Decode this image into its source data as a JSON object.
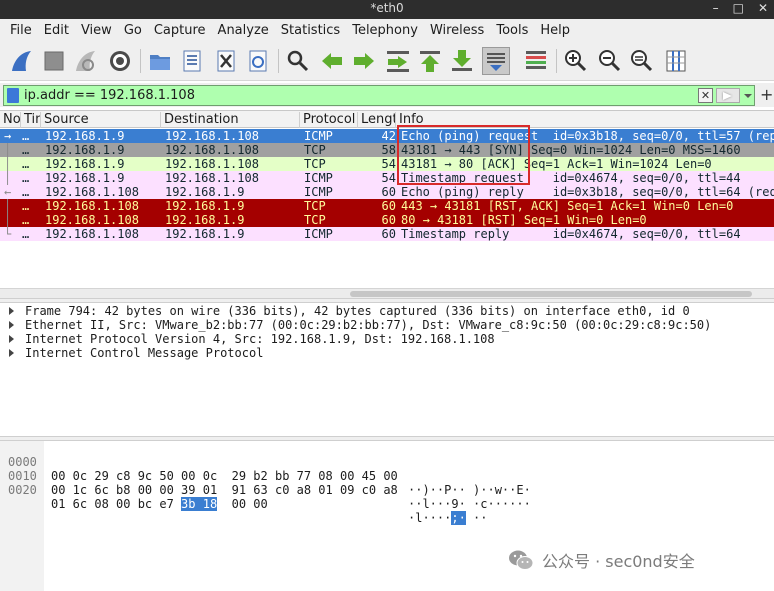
{
  "window": {
    "title": "*eth0",
    "controls": [
      "–",
      "□",
      "✕"
    ]
  },
  "menubar": [
    "File",
    "Edit",
    "View",
    "Go",
    "Capture",
    "Analyze",
    "Statistics",
    "Telephony",
    "Wireless",
    "Tools",
    "Help"
  ],
  "toolbar": {
    "icons": [
      "shark-fin-start-icon",
      "stop-capture-icon",
      "restart-capture-icon",
      "capture-options-gear-icon",
      "open-file-icon",
      "save-file-icon",
      "close-file-icon",
      "reload-file-icon",
      "find-packet-icon",
      "go-back-icon",
      "go-forward-icon",
      "go-to-packet-icon",
      "go-first-icon",
      "go-last-icon",
      "auto-scroll-icon",
      "colorize-icon",
      "zoom-in-icon",
      "zoom-out-icon",
      "normal-size-icon",
      "resize-columns-icon"
    ],
    "colors": {
      "shark": "#3b6fc2",
      "arrow": "#5fae2e",
      "stop": "#8e8e8e"
    }
  },
  "filter": {
    "value": "ip.addr == 192.168.1.108",
    "clear_label": "✕",
    "plus_label": "+"
  },
  "packet_list": {
    "columns": [
      "No",
      "Tin",
      "Source",
      "Destination",
      "Protocol",
      "Lengt",
      "Info"
    ],
    "rows": [
      {
        "no": "…",
        "src": "192.168.1.9",
        "dst": "192.168.1.108",
        "proto": "ICMP",
        "len": "42",
        "info": "Echo (ping) request  id=0x3b18, seq=0/0, ttl=57 (rep",
        "bg": "#3a7ed1",
        "fg": "#ffffff"
      },
      {
        "no": "…",
        "src": "192.168.1.9",
        "dst": "192.168.1.108",
        "proto": "TCP",
        "len": "58",
        "info": "43181 → 443 [SYN] Seq=0 Win=1024 Len=0 MSS=1460",
        "bg": "#a0a0a0",
        "fg": "#12272e"
      },
      {
        "no": "…",
        "src": "192.168.1.9",
        "dst": "192.168.1.108",
        "proto": "TCP",
        "len": "54",
        "info": "43181 → 80 [ACK] Seq=1 Ack=1 Win=1024 Len=0",
        "bg": "#e4ffc7",
        "fg": "#12272e"
      },
      {
        "no": "…",
        "src": "192.168.1.9",
        "dst": "192.168.1.108",
        "proto": "ICMP",
        "len": "54",
        "info": "Timestamp request    id=0x4674, seq=0/0, ttl=44",
        "bg": "#fce0ff",
        "fg": "#12272e"
      },
      {
        "no": "…",
        "src": "192.168.1.108",
        "dst": "192.168.1.9",
        "proto": "ICMP",
        "len": "60",
        "info": "Echo (ping) reply    id=0x3b18, seq=0/0, ttl=64 (req",
        "bg": "#fce0ff",
        "fg": "#12272e"
      },
      {
        "no": "…",
        "src": "192.168.1.108",
        "dst": "192.168.1.9",
        "proto": "TCP",
        "len": "60",
        "info": "443 → 43181 [RST, ACK] Seq=1 Ack=1 Win=0 Len=0",
        "bg": "#a40000",
        "fg": "#fffc9c"
      },
      {
        "no": "…",
        "src": "192.168.1.108",
        "dst": "192.168.1.9",
        "proto": "TCP",
        "len": "60",
        "info": "80 → 43181 [RST] Seq=1 Win=0 Len=0",
        "bg": "#a40000",
        "fg": "#fffc9c"
      },
      {
        "no": "…",
        "src": "192.168.1.108",
        "dst": "192.168.1.9",
        "proto": "ICMP",
        "len": "60",
        "info": "Timestamp reply      id=0x4674, seq=0/0, ttl=64",
        "bg": "#fce0ff",
        "fg": "#12272e"
      }
    ]
  },
  "details": [
    "Frame 794: 42 bytes on wire (336 bits), 42 bytes captured (336 bits) on interface eth0, id 0",
    "Ethernet II, Src: VMware_b2:bb:77 (00:0c:29:b2:bb:77), Dst: VMware_c8:9c:50 (00:0c:29:c8:9c:50)",
    "Internet Protocol Version 4, Src: 192.168.1.9, Dst: 192.168.1.108",
    "Internet Control Message Protocol"
  ],
  "bytes": [
    {
      "offset": "0000",
      "hex": "00 0c 29 c8 9c 50 00 0c  29 b2 bb 77 08 00 45 00",
      "hex_hl": "",
      "hex_post": "",
      "ascii": "··)··P·· )··w··E·",
      "ascii_hl": "",
      "ascii_post": ""
    },
    {
      "offset": "0010",
      "hex": "00 1c 6c b8 00 00 39 01  91 63 c0 a8 01 09 c0 a8",
      "hex_hl": "",
      "hex_post": "",
      "ascii": "··l···9· ·c······",
      "ascii_hl": "",
      "ascii_post": ""
    },
    {
      "offset": "0020",
      "hex": "01 6c 08 00 bc e7 ",
      "hex_hl": "3b 18",
      "hex_post": "  00 00",
      "ascii": "·l····",
      "ascii_hl": ";·",
      "ascii_post": " ··"
    }
  ],
  "watermark": {
    "text": "公众号 · sec0nd安全",
    "icon": "wechat-icon"
  }
}
